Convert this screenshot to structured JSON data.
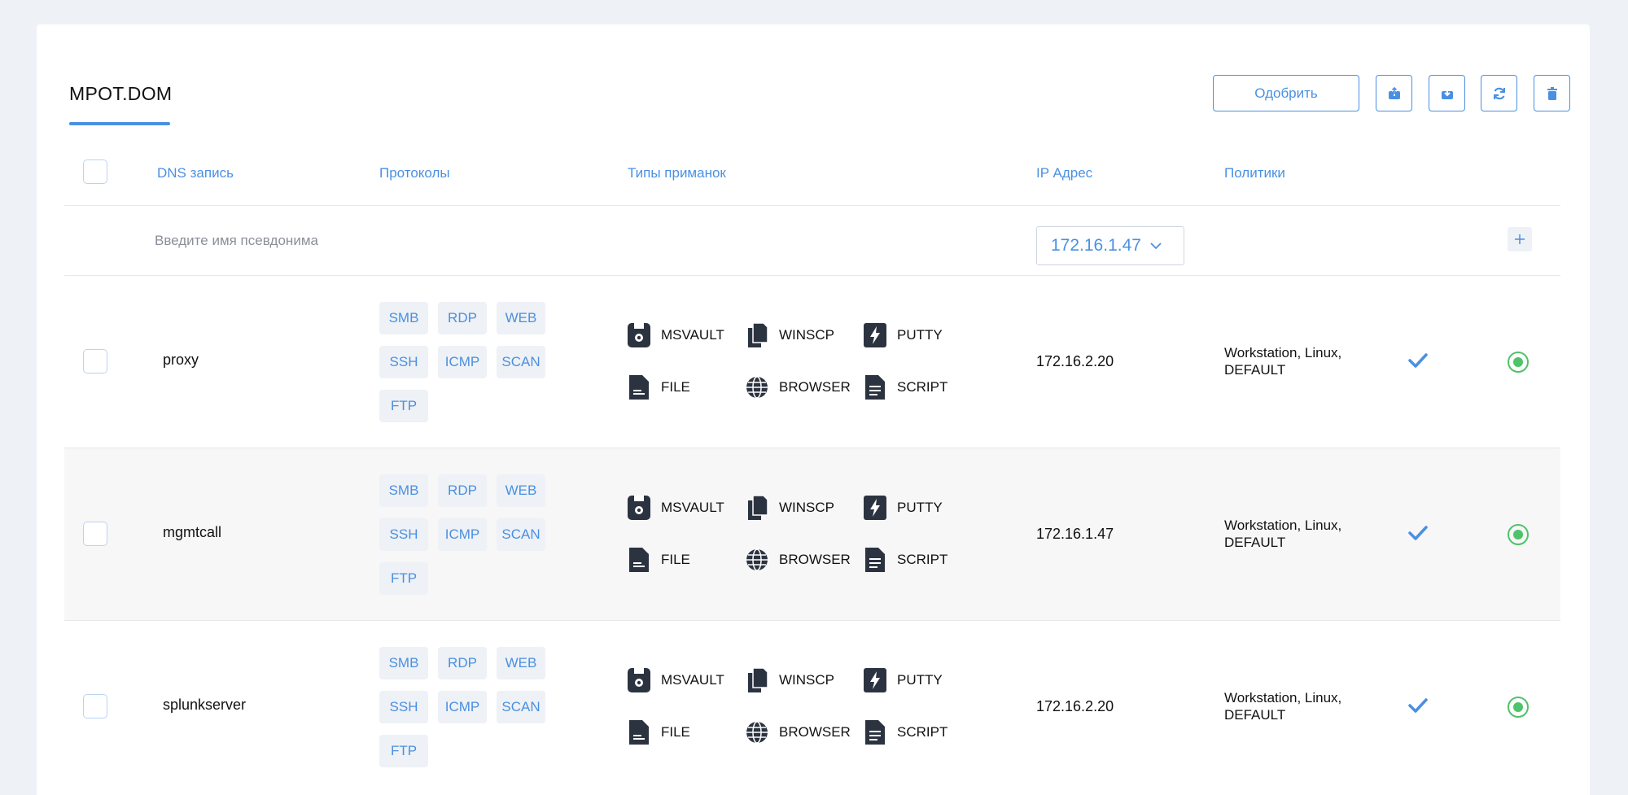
{
  "page": {
    "title": "MPOT.DOM"
  },
  "toolbar": {
    "approve_label": "Одобрить",
    "icons": [
      "upload-icon",
      "download-icon",
      "refresh-icon",
      "trash-icon"
    ]
  },
  "table": {
    "headers": {
      "dns": "DNS запись",
      "protocols": "Протоколы",
      "lure_types": "Типы приманок",
      "ip": "IP Адрес",
      "policies": "Политики"
    },
    "new_row": {
      "alias_placeholder": "Введите имя псевдонима",
      "ip_selected": "172.16.1.47"
    },
    "protocol_labels": [
      "SMB",
      "RDP",
      "WEB",
      "SSH",
      "ICMP",
      "SCAN",
      "FTP"
    ],
    "lure_labels": [
      "MSVAULT",
      "WINSCP",
      "PUTTY",
      "FILE",
      "BROWSER",
      "SCRIPT"
    ],
    "rows": [
      {
        "dns": "proxy",
        "ip": "172.16.2.20",
        "policies": "Workstation, Linux, DEFAULT"
      },
      {
        "dns": "mgmtcall",
        "ip": "172.16.1.47",
        "policies": "Workstation, Linux, DEFAULT"
      },
      {
        "dns": "splunkserver",
        "ip": "172.16.2.20",
        "policies": "Workstation, Linux, DEFAULT"
      }
    ]
  },
  "colors": {
    "accent": "#4a90e2",
    "success": "#4fc36a",
    "tag_bg": "#eef1f5"
  }
}
